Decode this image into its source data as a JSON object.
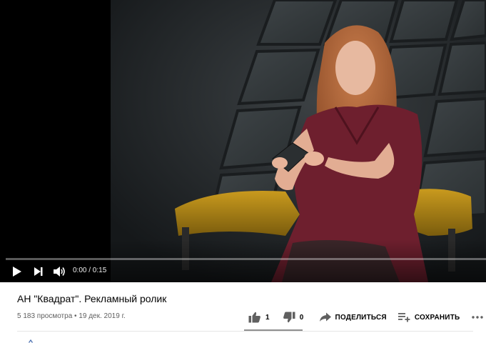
{
  "player": {
    "current_time": "0:00",
    "duration": "0:15",
    "time_display": "0:00 / 0:15",
    "progress_fraction": 0.0,
    "icons": {
      "play": "play-icon",
      "next": "next-icon",
      "volume": "volume-icon"
    },
    "colors": {
      "progress": "#ff0000",
      "track": "#ffffff"
    }
  },
  "video": {
    "title": "АН \"Квадрат\". Рекламный ролик",
    "views": "5 183 просмотра",
    "date": "19 дек. 2019 г.",
    "meta_line": "5 183 просмотра • 19 дек. 2019 г."
  },
  "actions": {
    "like_count": "1",
    "dislike_count": "0",
    "share_label": "ПОДЕЛИТЬСЯ",
    "save_label": "СОХРАНИТЬ",
    "icons": {
      "like": "thumb-up-icon",
      "dislike": "thumb-down-icon",
      "share": "share-arrow-icon",
      "save": "playlist-add-icon",
      "more": "more-horizontal-icon"
    }
  }
}
